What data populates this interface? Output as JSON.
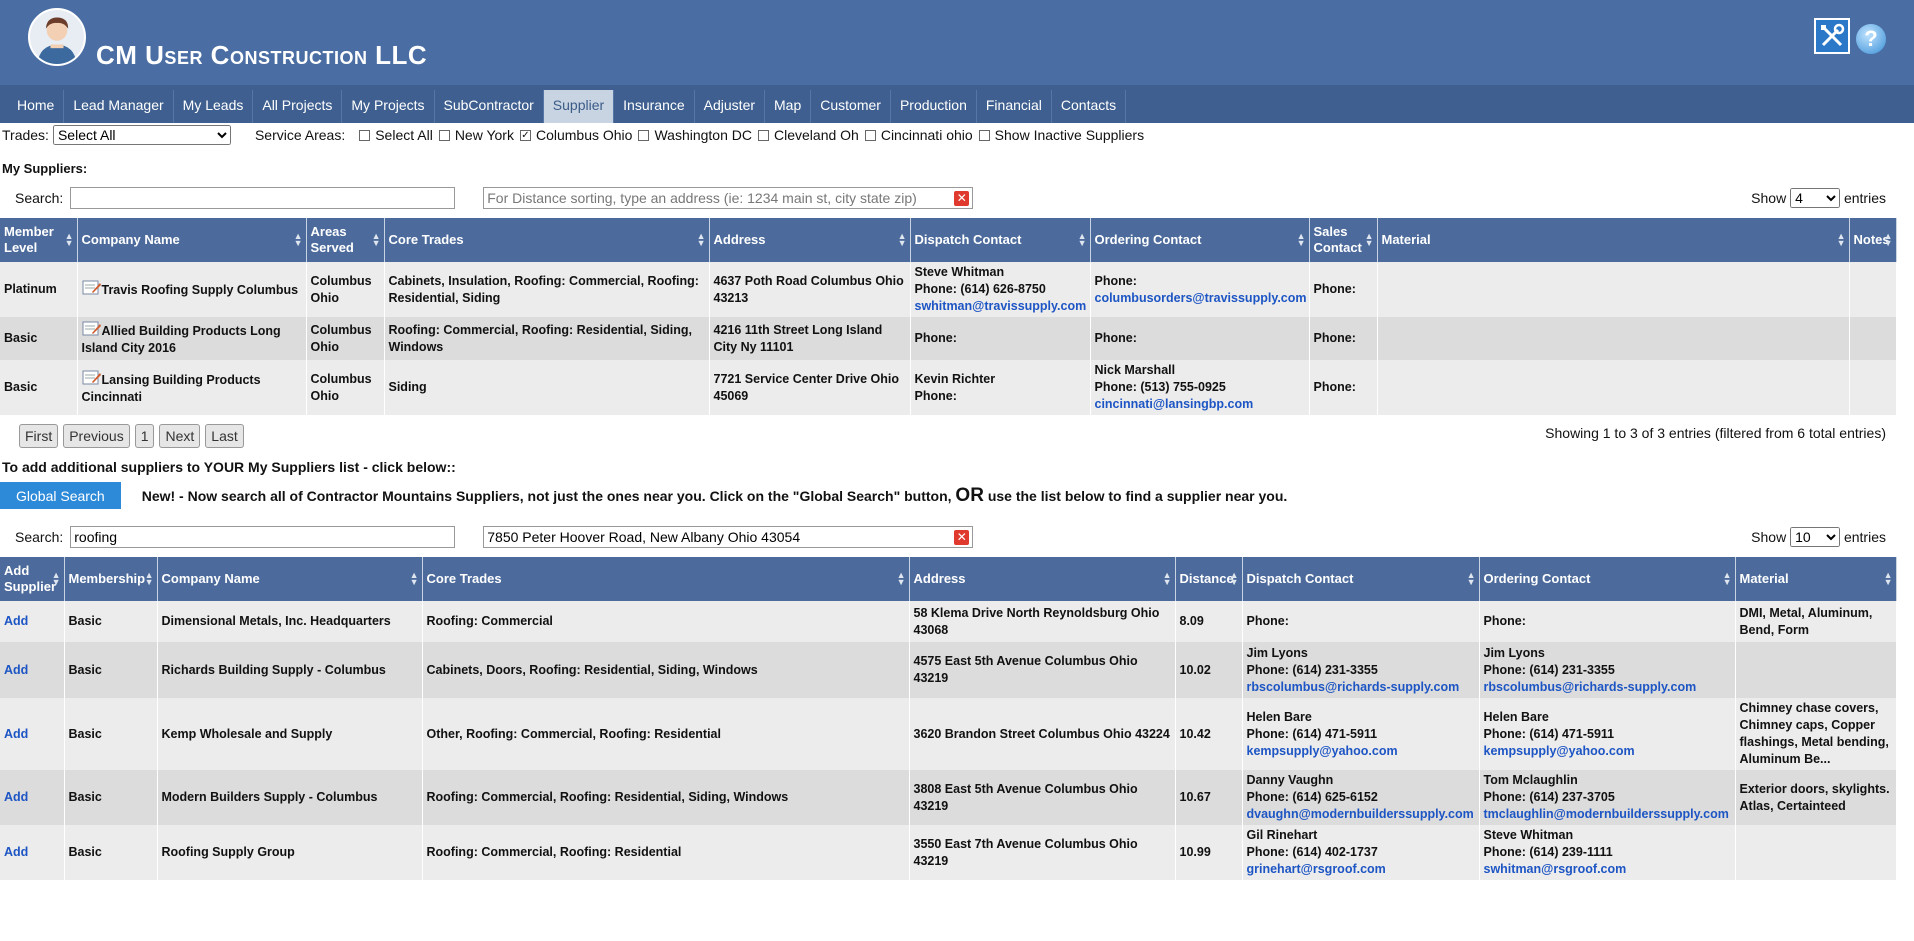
{
  "header": {
    "company_name": "CM User Construction LLC"
  },
  "nav": [
    "Home",
    "Lead Manager",
    "My Leads",
    "All Projects",
    "My Projects",
    "SubContractor",
    "Supplier",
    "Insurance",
    "Adjuster",
    "Map",
    "Customer",
    "Production",
    "Financial",
    "Contacts"
  ],
  "nav_active": "Supplier",
  "filters": {
    "trades_label": "Trades:",
    "trades_value": "Select All",
    "service_areas_label": "Service Areas:",
    "options": [
      {
        "label": "Select All",
        "checked": false
      },
      {
        "label": "New York",
        "checked": false
      },
      {
        "label": "Columbus Ohio",
        "checked": true
      },
      {
        "label": "Washington DC",
        "checked": false
      },
      {
        "label": "Cleveland Oh",
        "checked": false
      },
      {
        "label": "Cincinnati ohio",
        "checked": false
      },
      {
        "label": "Show Inactive Suppliers",
        "checked": false
      }
    ]
  },
  "my_suppliers": {
    "title": "My Suppliers:",
    "search_label": "Search:",
    "search_value": "",
    "address_placeholder": "For Distance sorting, type an address (ie: 1234 main st, city state zip)",
    "show_label": "Show",
    "show_value": "4",
    "entries_label": "entries",
    "columns": [
      "Member Level",
      "Company Name",
      "Areas Served",
      "Core Trades",
      "Address",
      "Dispatch Contact",
      "Ordering Contact",
      "Sales Contact",
      "Material",
      "Notes"
    ],
    "rows": [
      {
        "level": "Platinum",
        "company": "Travis Roofing Supply Columbus",
        "areas": "Columbus Ohio",
        "trades": "Cabinets, Insulation, Roofing: Commercial, Roofing: Residential, Siding",
        "address": "4637 Poth Road Columbus Ohio 43213",
        "dispatch_name": "Steve Whitman",
        "dispatch_phone": "Phone: (614) 626-8750",
        "dispatch_email": "swhitman@travissupply.com",
        "ordering_name": "",
        "ordering_phone": "Phone:",
        "ordering_email": "columbusorders@travissupply.com",
        "sales_phone": "Phone:"
      },
      {
        "level": "Basic",
        "company": "Allied Building Products Long Island City 2016",
        "areas": "Columbus Ohio",
        "trades": "Roofing: Commercial, Roofing: Residential, Siding, Windows",
        "address": "4216 11th Street Long Island City Ny 11101",
        "dispatch_name": "",
        "dispatch_phone": "Phone:",
        "dispatch_email": "",
        "ordering_name": "",
        "ordering_phone": "Phone:",
        "ordering_email": "",
        "sales_phone": "Phone:"
      },
      {
        "level": "Basic",
        "company": "Lansing Building Products Cincinnati",
        "areas": "Columbus Ohio",
        "trades": "Siding",
        "address": "7721 Service Center Drive Ohio 45069",
        "dispatch_name": "Kevin Richter",
        "dispatch_phone": "Phone:",
        "dispatch_email": "",
        "ordering_name": "Nick Marshall",
        "ordering_phone": "Phone: (513) 755-0925",
        "ordering_email": "cincinnati@lansingbp.com",
        "sales_phone": "Phone:"
      }
    ],
    "pager": [
      "First",
      "Previous",
      "1",
      "Next",
      "Last"
    ],
    "showing": "Showing 1 to 3 of 3 entries (filtered from 6 total entries)"
  },
  "add_line": "To add additional suppliers to YOUR My Suppliers list - click below::",
  "global_search": {
    "button": "Global Search",
    "text_before": "New! - Now search all of Contractor Mountains Suppliers, not just the ones near you. Click on the \"Global Search\" button,",
    "or": "OR",
    "text_after": "use the list below to find a supplier near you."
  },
  "all_suppliers": {
    "search_label": "Search:",
    "search_value": "roofing",
    "address_value": "7850 Peter Hoover Road, New Albany Ohio 43054",
    "show_label": "Show",
    "show_value": "10",
    "entries_label": "entries",
    "columns": [
      "Add Supplier",
      "Membership",
      "Company Name",
      "Core Trades",
      "Address",
      "Distance",
      "Dispatch Contact",
      "Ordering Contact",
      "Material"
    ],
    "rows": [
      {
        "add": "Add",
        "membership": "Basic",
        "company": "Dimensional Metals, Inc. Headquarters",
        "trades": "Roofing: Commercial",
        "address": "58 Klema Drive North Reynoldsburg Ohio 43068",
        "distance": "8.09",
        "dispatch_name": "",
        "dispatch_phone": "Phone:",
        "dispatch_email": "",
        "ordering_name": "",
        "ordering_phone": "Phone:",
        "ordering_email": "",
        "material": "DMI, Metal, Aluminum, Bend, Form"
      },
      {
        "add": "Add",
        "membership": "Basic",
        "company": "Richards Building Supply - Columbus",
        "trades": "Cabinets, Doors, Roofing: Residential, Siding, Windows",
        "address": "4575 East 5th Avenue Columbus Ohio 43219",
        "distance": "10.02",
        "dispatch_name": "Jim Lyons",
        "dispatch_phone": "Phone: (614) 231-3355",
        "dispatch_email": "rbscolumbus@richards-supply.com",
        "ordering_name": "Jim Lyons",
        "ordering_phone": "Phone: (614) 231-3355",
        "ordering_email": "rbscolumbus@richards-supply.com",
        "material": ""
      },
      {
        "add": "Add",
        "membership": "Basic",
        "company": "Kemp Wholesale and Supply",
        "trades": "Other, Roofing: Commercial, Roofing: Residential",
        "address": "3620 Brandon Street Columbus Ohio 43224",
        "distance": "10.42",
        "dispatch_name": "Helen Bare",
        "dispatch_phone": "Phone: (614) 471-5911",
        "dispatch_email": "kempsupply@yahoo.com",
        "ordering_name": "Helen Bare",
        "ordering_phone": "Phone: (614) 471-5911",
        "ordering_email": "kempsupply@yahoo.com",
        "material": "Chimney chase covers, Chimney caps, Copper flashings, Metal bending, Aluminum Be..."
      },
      {
        "add": "Add",
        "membership": "Basic",
        "company": "Modern Builders Supply - Columbus",
        "trades": "Roofing: Commercial, Roofing: Residential, Siding, Windows",
        "address": "3808 East 5th Avenue Columbus Ohio 43219",
        "distance": "10.67",
        "dispatch_name": "Danny Vaughn",
        "dispatch_phone": "Phone: (614) 625-6152",
        "dispatch_email": "dvaughn@modernbuilderssupply.com",
        "ordering_name": "Tom Mclaughlin",
        "ordering_phone": "Phone: (614) 237-3705",
        "ordering_email": "tmclaughlin@modernbuilderssupply.com",
        "material": "Exterior doors, skylights. Atlas, Certainteed"
      },
      {
        "add": "Add",
        "membership": "Basic",
        "company": "Roofing Supply Group",
        "trades": "Roofing: Commercial, Roofing: Residential",
        "address": "3550 East 7th Avenue Columbus Ohio 43219",
        "distance": "10.99",
        "dispatch_name": "Gil Rinehart",
        "dispatch_phone": "Phone: (614) 402-1737",
        "dispatch_email": "grinehart@rsgroof.com",
        "ordering_name": "Steve Whitman",
        "ordering_phone": "Phone: (614) 239-1111",
        "ordering_email": "swhitman@rsgroof.com",
        "material": ""
      }
    ]
  },
  "colors": {
    "header_bg": "#4a6ea3",
    "nav_bg": "#3e5f8f",
    "table_header_bg": "#4c6b9c",
    "link": "#1d55c4",
    "button_blue": "#2d8ad8"
  }
}
